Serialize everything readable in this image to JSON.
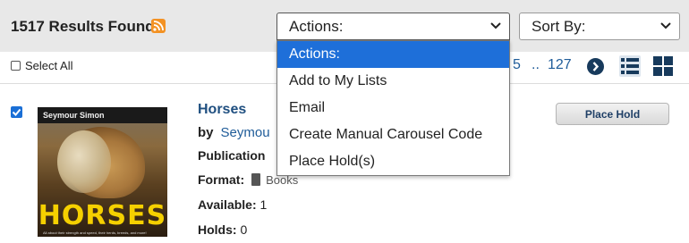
{
  "results": {
    "count_text": "1517 Results Found",
    "rss_icon": "rss-icon"
  },
  "actions_select": {
    "value": "Actions:",
    "options": [
      "Actions:",
      "Add to My Lists",
      "Email",
      "Create Manual Carousel Code",
      "Place Hold(s)"
    ],
    "selected_index": 0
  },
  "sort_select": {
    "value": "Sort By:"
  },
  "toolbar": {
    "select_all_label": "Select All",
    "pager": {
      "page_5": "5",
      "ellipsis": "..",
      "last_page": "127"
    }
  },
  "item": {
    "checked": true,
    "cover": {
      "author_text": "Seymour Simon",
      "title_text": "HORSES",
      "subtitle_text": "All about their strength and speed, their herds, breeds, and more!"
    },
    "title": "Horses",
    "by_label": "by",
    "author": "Seymou",
    "publication_label": "Publication",
    "format_label": "Format:",
    "format_value": "Books",
    "available_label": "Available:",
    "available_value": "1",
    "holds_label": "Holds:",
    "holds_value": "0",
    "place_hold_label": "Place Hold"
  },
  "colors": {
    "header_bg": "#e8e8e8",
    "link": "#1f5c99",
    "selected_option": "#1e6fd9",
    "rss": "#f39224"
  }
}
